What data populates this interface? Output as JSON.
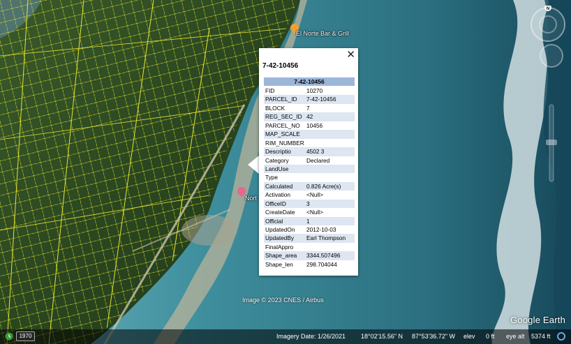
{
  "map": {
    "imagery_credit": "Image © 2023 CNES / Airbus",
    "brand": "Google Earth",
    "places": [
      {
        "name": "El Norte Bar & Grill",
        "icon": "restaurant-pin-icon"
      },
      {
        "name": "Nort",
        "icon": "pink-pin-icon"
      }
    ]
  },
  "popup": {
    "title": "7-42-10456",
    "close_label": "✕",
    "table_header": "7-42-10456",
    "rows": [
      {
        "key": "FID",
        "value": "10270"
      },
      {
        "key": "PARCEL_ID",
        "value": "7-42-10456"
      },
      {
        "key": "BLOCK",
        "value": "7"
      },
      {
        "key": "REG_SEC_ID",
        "value": "42"
      },
      {
        "key": "PARCEL_NO",
        "value": "10456"
      },
      {
        "key": "MAP_SCALE",
        "value": ""
      },
      {
        "key": "RIM_NUMBER",
        "value": ""
      },
      {
        "key": "Descriptio",
        "value": "4502 3"
      },
      {
        "key": "Category",
        "value": "Declared"
      },
      {
        "key": "LandUse",
        "value": ""
      },
      {
        "key": "Type",
        "value": ""
      },
      {
        "key": "Calculated",
        "value": "0.826 Acre(s)"
      },
      {
        "key": "Activation",
        "value": "<Null>"
      },
      {
        "key": "OfficeID",
        "value": "3"
      },
      {
        "key": "CreateDate",
        "value": "<Null>"
      },
      {
        "key": "Official",
        "value": "1"
      },
      {
        "key": "UpdatedOn",
        "value": "2012-10-03"
      },
      {
        "key": "UpdatedBy",
        "value": "Earl Thompson"
      },
      {
        "key": "FinalAppro",
        "value": ""
      },
      {
        "key": "Shape_area",
        "value": "3344.507496"
      },
      {
        "key": "Shape_len",
        "value": "298.704044"
      }
    ]
  },
  "controls": {
    "compass_label": "N"
  },
  "status": {
    "year": "1970",
    "imagery_date": "Imagery Date: 1/26/2021",
    "latitude": "18°02'15.56\" N",
    "longitude": "87°53'36.72\" W",
    "elev_label": "elev",
    "elev_value": "0 ft",
    "eye_alt_label": "eye alt",
    "eye_alt_value": "5374 ft"
  },
  "colors": {
    "parcel_lines": "#e6e62a",
    "land": "#2f4a22",
    "water_shallow": "#5aa9b8",
    "water_deep": "#1f5a6e",
    "popup_header": "#9cb6d8",
    "popup_alt_row": "#dde6f1"
  }
}
